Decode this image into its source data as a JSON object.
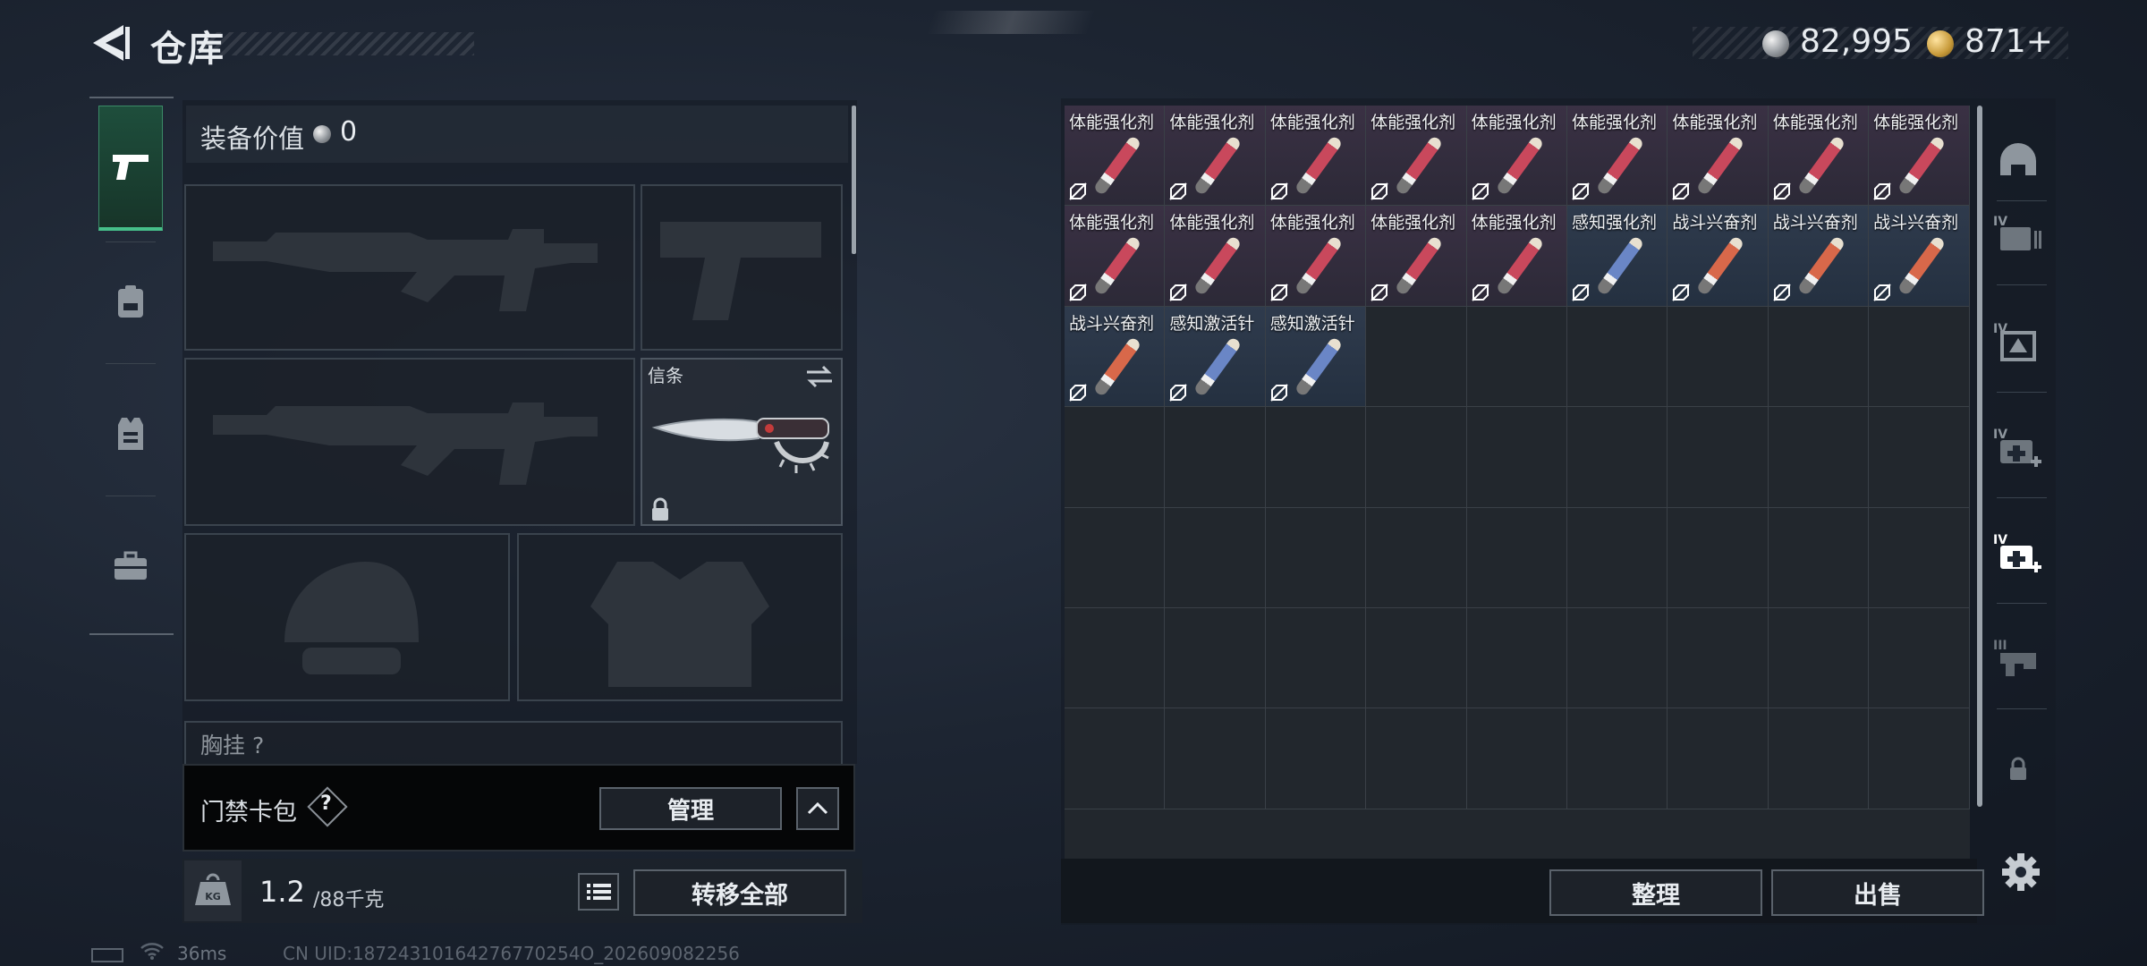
{
  "header": {
    "title": "仓库",
    "currency": {
      "silver_amount": "82,995",
      "gold_amount": "871",
      "gold_add_symbol": "+"
    }
  },
  "left_rail": {
    "tabs": [
      {
        "name": "weapons",
        "icon": "pistol-icon",
        "selected": true
      },
      {
        "name": "backpack",
        "icon": "backpack-icon",
        "selected": false
      },
      {
        "name": "vest",
        "icon": "vest-icon",
        "selected": false
      },
      {
        "name": "case",
        "icon": "briefcase-icon",
        "selected": false
      }
    ]
  },
  "equipment": {
    "value_label": "装备价值",
    "value": "0",
    "melee_label": "信条",
    "chest_label": "胸挂 ?"
  },
  "keycard": {
    "label": "门禁卡包",
    "help": "?",
    "manage_label": "管理"
  },
  "weight": {
    "current": "1.2",
    "max": "/88千克",
    "transfer_all_label": "转移全部"
  },
  "storage": {
    "columns": 9,
    "total_cells": 63,
    "items": [
      {
        "name": "体能强化剂",
        "color": "red"
      },
      {
        "name": "体能强化剂",
        "color": "red"
      },
      {
        "name": "体能强化剂",
        "color": "red"
      },
      {
        "name": "体能强化剂",
        "color": "red"
      },
      {
        "name": "体能强化剂",
        "color": "red"
      },
      {
        "name": "体能强化剂",
        "color": "red"
      },
      {
        "name": "体能强化剂",
        "color": "red"
      },
      {
        "name": "体能强化剂",
        "color": "red"
      },
      {
        "name": "体能强化剂",
        "color": "red"
      },
      {
        "name": "体能强化剂",
        "color": "red"
      },
      {
        "name": "体能强化剂",
        "color": "red"
      },
      {
        "name": "体能强化剂",
        "color": "red"
      },
      {
        "name": "体能强化剂",
        "color": "red"
      },
      {
        "name": "体能强化剂",
        "color": "red"
      },
      {
        "name": "感知强化剂",
        "color": "blue"
      },
      {
        "name": "战斗兴奋剂",
        "color": "orange"
      },
      {
        "name": "战斗兴奋剂",
        "color": "orange"
      },
      {
        "name": "战斗兴奋剂",
        "color": "orange"
      },
      {
        "name": "战斗兴奋剂",
        "color": "orange"
      },
      {
        "name": "感知激活针",
        "color": "blue"
      },
      {
        "name": "感知激活针",
        "color": "blue"
      }
    ],
    "sort_label": "整理",
    "sell_label": "出售"
  },
  "right_rail": {
    "icons": [
      "helmet-category-icon",
      "case-iv-icon",
      "armor-iv-icon",
      "medkit-iv-icon",
      "medkit-iv-selected-icon",
      "ammo-iii-icon",
      "lock-icon"
    ],
    "tiers": [
      "",
      "IV",
      "IV",
      "IV",
      "IV",
      "III",
      ""
    ]
  },
  "status": {
    "ping": "36ms",
    "uid": "CN UID:18724310164276770254O_202609082256"
  },
  "colors": {
    "accent_green": "#46c08a",
    "item_red": "#c9485c",
    "item_blue": "#6a86c6",
    "item_orange": "#d8684a"
  }
}
